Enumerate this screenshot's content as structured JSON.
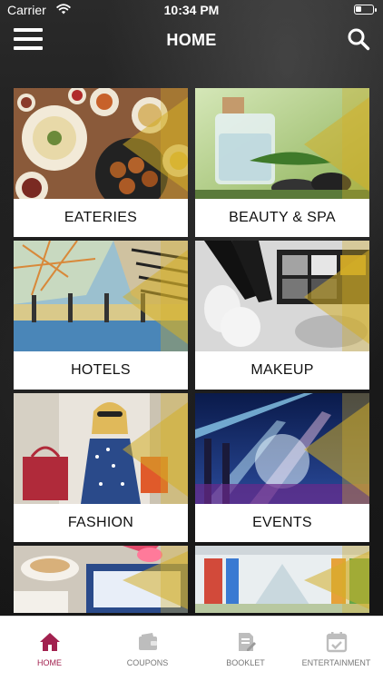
{
  "status": {
    "carrier": "Carrier",
    "time": "10:34 PM"
  },
  "nav": {
    "title": "HOME"
  },
  "categories": [
    {
      "label": "EATERIES"
    },
    {
      "label": "BEAUTY & SPA"
    },
    {
      "label": "HOTELS"
    },
    {
      "label": "MAKEUP"
    },
    {
      "label": "FASHION"
    },
    {
      "label": "EVENTS"
    },
    {
      "label": ""
    },
    {
      "label": ""
    }
  ],
  "tabs": [
    {
      "label": "HOME",
      "icon": "home-icon",
      "active": true
    },
    {
      "label": "COUPONS",
      "icon": "wallet-icon",
      "active": false
    },
    {
      "label": "BOOKLET",
      "icon": "booklet-icon",
      "active": false
    },
    {
      "label": "ENTERTAINMENT",
      "icon": "calendar-check-icon",
      "active": false
    }
  ],
  "colors": {
    "accent": "#a2214f",
    "inactive": "#bdbdbd",
    "gold": "#d4af28"
  }
}
